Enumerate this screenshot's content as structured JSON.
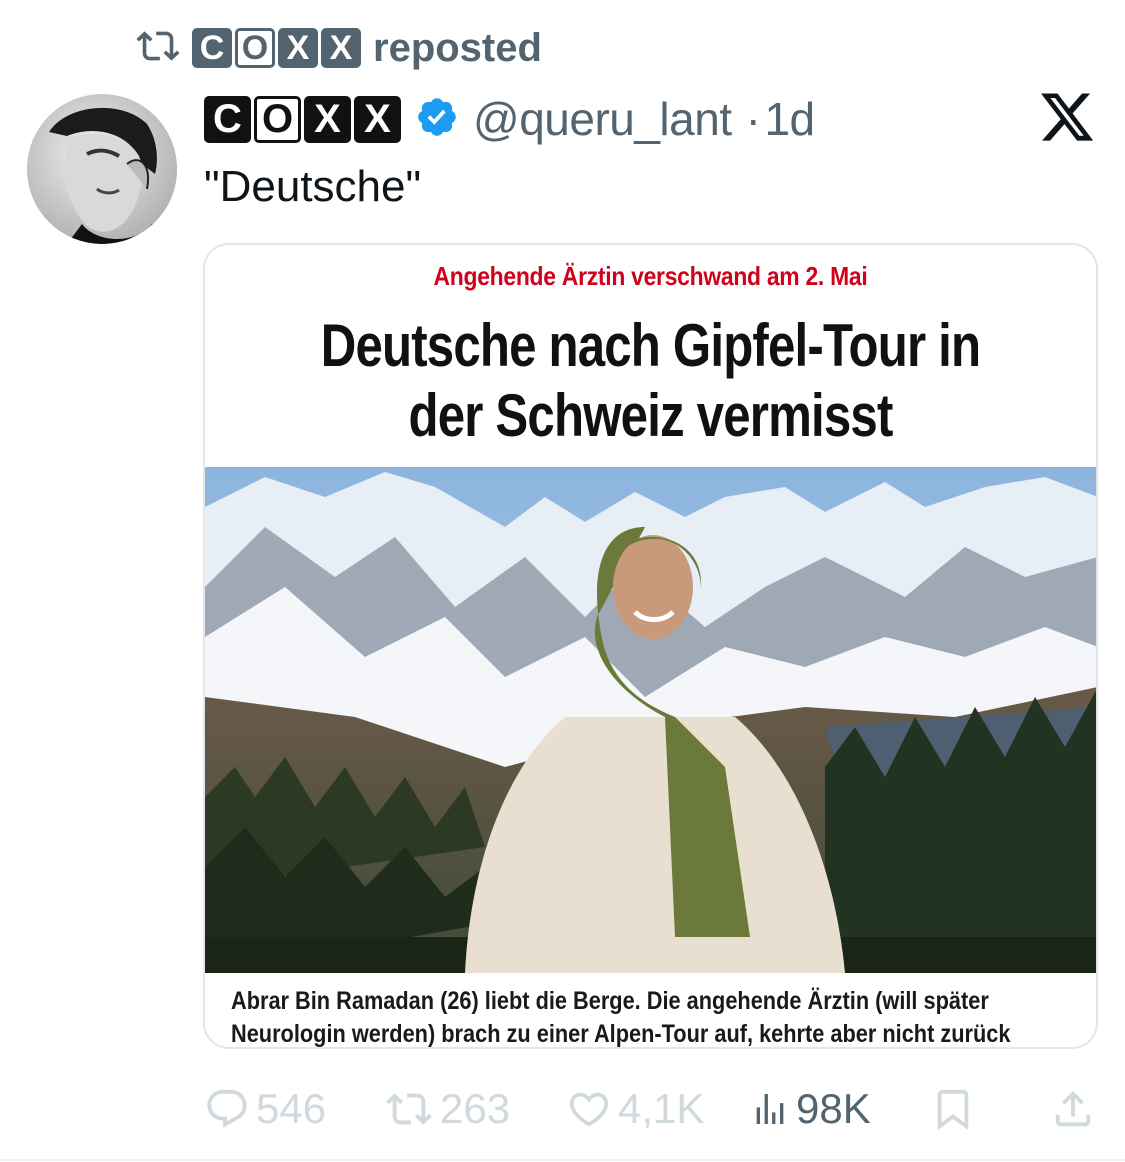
{
  "repost": {
    "icon": "repost-icon",
    "user_letters": [
      "C",
      "O",
      "X",
      "X"
    ],
    "label": "reposted"
  },
  "tweet": {
    "display_letters": [
      "C",
      "O",
      "X",
      "X"
    ],
    "verified_icon": "verified-badge-icon",
    "handle": "@queru_lant",
    "separator": "·",
    "time": "1d",
    "text": "\"Deutsche\"",
    "platform_icon": "x-logo-icon"
  },
  "card": {
    "kicker": "Angehende Ärztin verschwand am 2. Mai",
    "headline": "Deutsche nach Gipfel-Tour in der Schweiz vermisst",
    "caption": "Abrar Bin Ramadan (26) liebt die Berge. Die angehende Ärztin (will später Neurologin werden) brach zu einer Alpen-Tour auf, kehrte aber nicht zurück",
    "kicker_color": "#d0021b"
  },
  "actions": {
    "replies": "546",
    "reposts": "263",
    "likes": "4,1K",
    "views": "98K",
    "bookmark_icon": "bookmark-icon",
    "share_icon": "share-icon"
  },
  "colors": {
    "secondary_text": "#536471",
    "faded_action": "#cfd9de",
    "verified_blue": "#1d9bf0"
  }
}
